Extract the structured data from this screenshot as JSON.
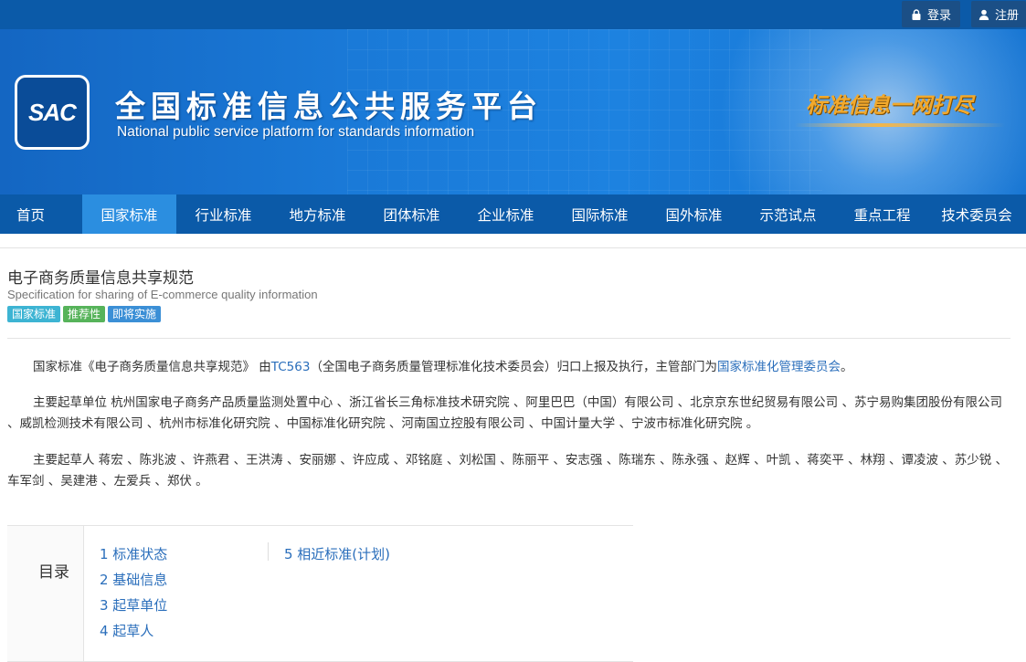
{
  "top_actions": {
    "login_label": "登录",
    "register_label": "注册"
  },
  "banner": {
    "logo_text": "SAC",
    "title": "全国标准信息公共服务平台",
    "subtitle": "National public service platform  for standards information",
    "slogan": "标准信息一网打尽"
  },
  "nav": {
    "items": [
      {
        "label": "首页"
      },
      {
        "label": "国家标准"
      },
      {
        "label": "行业标准"
      },
      {
        "label": "地方标准"
      },
      {
        "label": "团体标准"
      },
      {
        "label": "企业标准"
      },
      {
        "label": "国际标准"
      },
      {
        "label": "国外标准"
      },
      {
        "label": "示范试点"
      },
      {
        "label": "重点工程"
      },
      {
        "label": "技术委员会"
      }
    ]
  },
  "standard": {
    "title": "电子商务质量信息共享规范",
    "title_en": "Specification for sharing of E-commerce quality information",
    "badges": [
      "国家标准",
      "推荐性",
      "即将实施"
    ]
  },
  "description": {
    "p1_prefix": "国家标准《电子商务质量信息共享规范》 由",
    "p1_tc": "TC563",
    "p1_middle": "（全国电子商务质量管理标准化技术委员会）归口上报及执行，主管部门为",
    "p1_authority": "国家标准化管理委员会",
    "p1_suffix": "。",
    "p2": "主要起草单位 杭州国家电子商务产品质量监测处置中心 、浙江省长三角标准技术研究院 、阿里巴巴（中国）有限公司 、北京京东世纪贸易有限公司 、苏宁易购集团股份有限公司 、威凯检测技术有限公司 、杭州市标准化研究院 、中国标准化研究院 、河南国立控股有限公司 、中国计量大学 、宁波市标准化研究院 。",
    "p3": "主要起草人 蒋宏 、陈兆波 、许燕君 、王洪涛 、安丽娜 、许应成 、邓铭庭 、刘松国 、陈丽平 、安志强 、陈瑞东 、陈永强 、赵辉 、叶凯 、蒋奕平 、林翔 、谭凌波 、苏少锐 、车军剑 、吴建港 、左爱兵 、郑伏 。"
  },
  "toc": {
    "label": "目录",
    "items": [
      {
        "label": "1  标准状态"
      },
      {
        "label": "2  基础信息"
      },
      {
        "label": "3  起草单位"
      },
      {
        "label": "4  起草人"
      },
      {
        "label": "5  相近标准(计划)"
      }
    ]
  }
}
